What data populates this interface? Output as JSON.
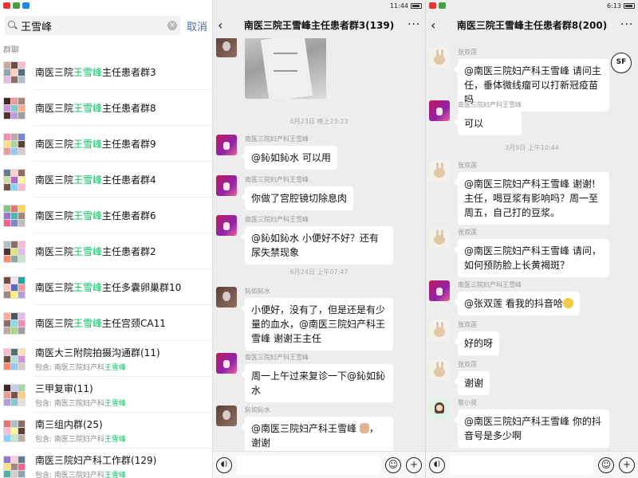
{
  "search_panel": {
    "status_time": "",
    "query": "王雪峰",
    "cancel_label": "取消",
    "section_label": "群聊",
    "results": [
      {
        "name_pre": "南医三院",
        "name_hl": "王雪峰",
        "name_post": "主任患者群3",
        "sub_pre": "",
        "sub_hl": ""
      },
      {
        "name_pre": "南医三院",
        "name_hl": "王雪峰",
        "name_post": "主任患者群8",
        "sub_pre": "",
        "sub_hl": ""
      },
      {
        "name_pre": "南医三院",
        "name_hl": "王雪峰",
        "name_post": "主任患者群9",
        "sub_pre": "",
        "sub_hl": ""
      },
      {
        "name_pre": "南医三院",
        "name_hl": "王雪峰",
        "name_post": "主任患者群4",
        "sub_pre": "",
        "sub_hl": ""
      },
      {
        "name_pre": "南医三院",
        "name_hl": "王雪峰",
        "name_post": "主任患者群6",
        "sub_pre": "",
        "sub_hl": ""
      },
      {
        "name_pre": "南医三院",
        "name_hl": "王雪峰",
        "name_post": "主任患者群2",
        "sub_pre": "",
        "sub_hl": ""
      },
      {
        "name_pre": "南医三院",
        "name_hl": "王雪峰",
        "name_post": "主任多囊卵巢群10",
        "sub_pre": "",
        "sub_hl": ""
      },
      {
        "name_pre": "南医三院",
        "name_hl": "王雪峰",
        "name_post": "主任宫颈CA11",
        "sub_pre": "",
        "sub_hl": ""
      },
      {
        "name_pre": "南医大三附院拍摄沟通群(11)",
        "name_hl": "",
        "name_post": "",
        "sub_pre": "包含: 南医三院妇产科",
        "sub_hl": "王雪峰"
      },
      {
        "name_pre": "三甲复审(11)",
        "name_hl": "",
        "name_post": "",
        "sub_pre": "包含: 南医三院妇产科",
        "sub_hl": "王雪峰"
      },
      {
        "name_pre": "南三组内群(25)",
        "name_hl": "",
        "name_post": "",
        "sub_pre": "包含: 南医三院妇产科",
        "sub_hl": "王雪峰"
      },
      {
        "name_pre": "南医三院妇产科工作群(129)",
        "name_hl": "",
        "name_post": "",
        "sub_pre": "包含: 南医三院妇产科",
        "sub_hl": "王雪峰"
      }
    ]
  },
  "chat1": {
    "status_time": "11:44",
    "title": "南医三院王雪峰主任患者群3(139)",
    "stamps": [
      "6月23日 晚上23:23",
      "6月24日 上午07:47"
    ],
    "messages": [
      {
        "sender": "南医三院妇产科王雪峰",
        "text": "@鈊如鈊水 可以用"
      },
      {
        "sender": "南医三院妇产科王雪峰",
        "text": "你做了宫腔镜切除息肉"
      },
      {
        "sender": "南医三院妇产科王雪峰",
        "text": "@鈊如鈊水 小便好不好？还有尿失禁现象"
      },
      {
        "sender": "鈊如鈊水",
        "text": "小便好，没有了，但是还是有少量的血水，@南医三院妇产科王雪峰  谢谢王主任"
      },
      {
        "sender": "南医三院妇产科王雪峰",
        "text": "周一上午过来复诊一下@鈊如鈊水"
      },
      {
        "sender": "鈊如鈊水",
        "text": "@南医三院妇产科王雪峰",
        "text_after": "，谢谢"
      }
    ]
  },
  "chat2": {
    "status_time": "6:13",
    "title": "南医三院王雪峰主任患者群8(200)",
    "stamps": [
      "3月9日 上午10:44"
    ],
    "sf_label": "SF",
    "messages": [
      {
        "sender": "张双莲",
        "text": "@南医三院妇产科王雪峰  请问主任，垂体微线瘤可以打新冠疫苗吗"
      },
      {
        "sender": "南医三院妇产科王雪峰",
        "text": "可以"
      },
      {
        "sender": "张双莲",
        "text": "@南医三院妇产科王雪峰  谢谢!主任，喝豆浆有影响吗？周一至周五，自己打的豆浆。"
      },
      {
        "sender": "张双莲",
        "text": "@南医三院妇产科王雪峰  请问，如何预防脸上长黄褐斑？"
      },
      {
        "sender": "南医三院妇产科王雪峰",
        "text": "@张双莲 看我的抖音哈"
      },
      {
        "sender": "张双莲",
        "text": "好的呀"
      },
      {
        "sender": "张双莲",
        "text": "谢谢"
      },
      {
        "sender": "黎小贤",
        "text": "@南医三院妇产科王雪峰 你的抖音号是多少啊"
      }
    ]
  },
  "colors": {
    "highlight": "#07c160",
    "link": "#576b95",
    "chat_bg": "#ededed"
  },
  "icons": [
    "search-icon",
    "clear-icon",
    "back-icon",
    "more-icon",
    "voice-icon",
    "emoji-icon",
    "plus-icon"
  ]
}
